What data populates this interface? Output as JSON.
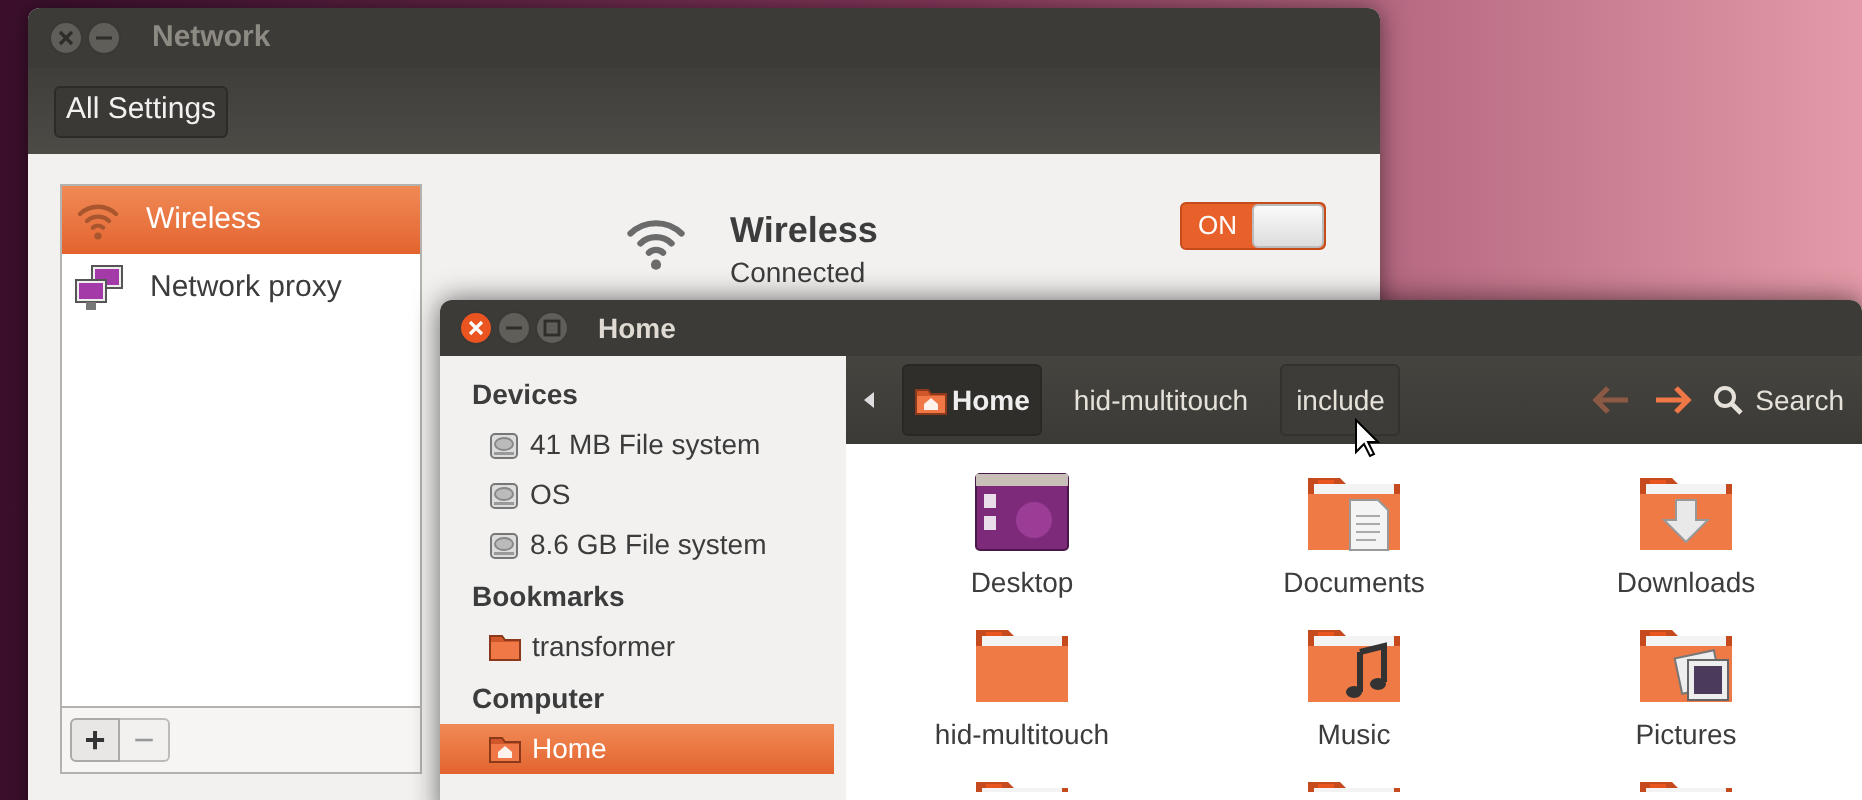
{
  "network_window": {
    "title": "Network",
    "toolbar_button": "All Settings",
    "connections": [
      {
        "name": "Wireless",
        "kind": "wireless",
        "selected": true
      },
      {
        "name": "Network proxy",
        "kind": "proxy",
        "selected": false
      }
    ],
    "list_buttons": [
      "+",
      "−"
    ],
    "detail": {
      "title": "Wireless",
      "status": "Connected",
      "switch": {
        "label": "ON",
        "on": true
      }
    }
  },
  "files_window": {
    "title": "Home",
    "sidebar": [
      {
        "heading": "Devices",
        "items": [
          {
            "name": "41 MB File system",
            "kind": "drive",
            "selected": false
          },
          {
            "name": "OS",
            "kind": "drive",
            "selected": false
          },
          {
            "name": "8.6 GB File system",
            "kind": "drive",
            "selected": false
          }
        ]
      },
      {
        "heading": "Bookmarks",
        "items": [
          {
            "name": "transformer",
            "kind": "folder",
            "selected": false
          }
        ]
      },
      {
        "heading": "Computer",
        "items": [
          {
            "name": "Home",
            "kind": "home",
            "selected": true
          }
        ]
      }
    ],
    "path": [
      {
        "label": "Home",
        "kind": "home",
        "selected": true,
        "hovered": false
      },
      {
        "label": "hid-multitouch",
        "kind": "folder",
        "selected": false,
        "hovered": false
      },
      {
        "label": "include",
        "kind": "folder",
        "selected": false,
        "hovered": true
      }
    ],
    "back_enabled": false,
    "forward_enabled": true,
    "search_label": "Search",
    "files": [
      {
        "name": "Desktop",
        "kind": "desktop"
      },
      {
        "name": "Documents",
        "kind": "documents"
      },
      {
        "name": "Downloads",
        "kind": "downloads"
      },
      {
        "name": "hid-multitouch",
        "kind": "folder"
      },
      {
        "name": "Music",
        "kind": "music"
      },
      {
        "name": "Pictures",
        "kind": "pictures"
      }
    ]
  }
}
